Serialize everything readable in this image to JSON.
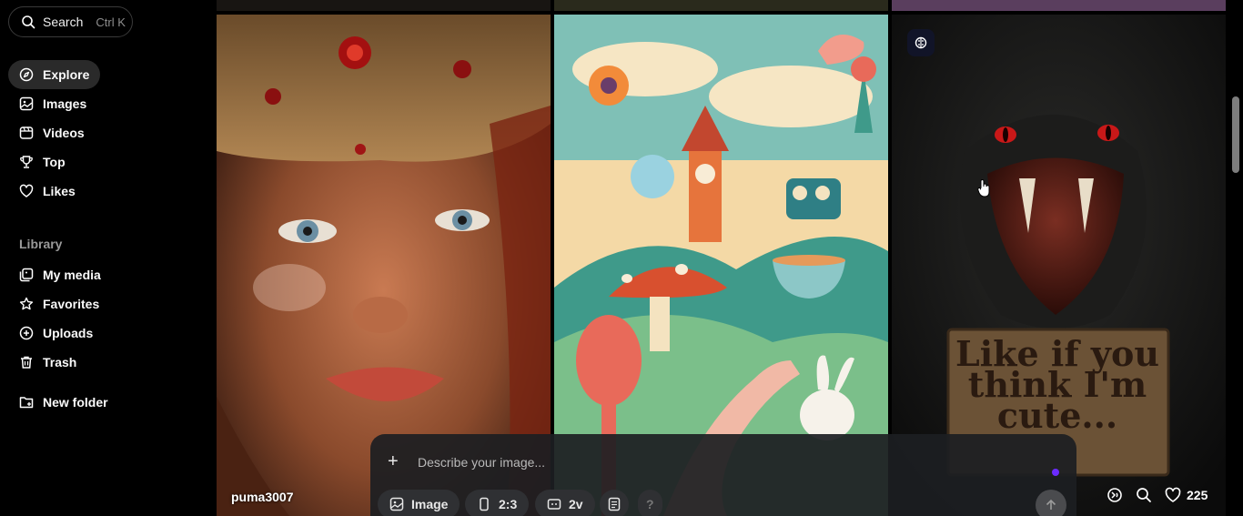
{
  "search": {
    "label": "Search",
    "shortcut": "Ctrl K"
  },
  "nav": {
    "items": [
      {
        "label": "Explore",
        "icon": "compass-icon"
      },
      {
        "label": "Images",
        "icon": "image-icon"
      },
      {
        "label": "Videos",
        "icon": "video-icon"
      },
      {
        "label": "Top",
        "icon": "trophy-icon"
      },
      {
        "label": "Likes",
        "icon": "heart-icon"
      }
    ]
  },
  "library": {
    "title": "Library",
    "items": [
      {
        "label": "My media",
        "icon": "media-icon"
      },
      {
        "label": "Favorites",
        "icon": "star-icon"
      },
      {
        "label": "Uploads",
        "icon": "plus-circle-icon"
      },
      {
        "label": "Trash",
        "icon": "trash-icon"
      },
      {
        "label": "New folder",
        "icon": "folder-plus-icon"
      }
    ]
  },
  "prompt": {
    "placeholder": "Describe your image...",
    "chips": [
      {
        "label": "Image",
        "icon": "image-icon"
      },
      {
        "label": "2:3",
        "icon": "portrait-icon"
      },
      {
        "label": "2v",
        "icon": "variations-icon"
      },
      {
        "label": "",
        "icon": "style-icon"
      },
      {
        "label": "",
        "icon": "help-icon"
      }
    ]
  },
  "gallery": {
    "author": "puma3007",
    "sign_text": "Like if you think I'm cute...",
    "likes": "225"
  },
  "colors": {
    "accent": "#6b2bff",
    "active_bg": "#2a2a2a"
  }
}
